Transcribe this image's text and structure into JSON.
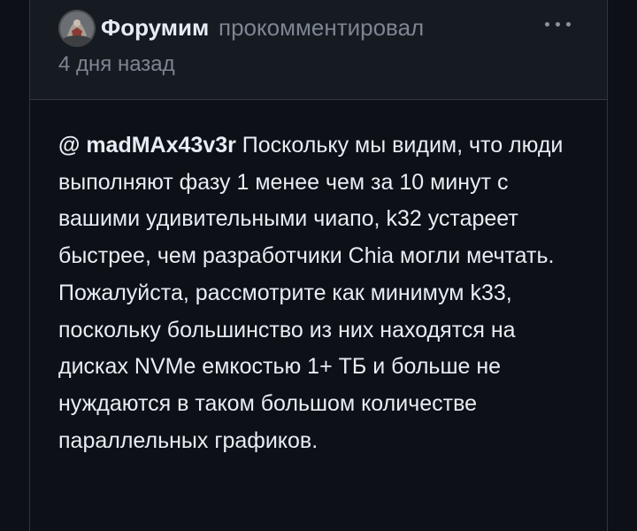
{
  "comment": {
    "author": "Форумим",
    "action": "прокомментировал",
    "timestamp": "4 дня назад",
    "mention": "@ madMAx43v3r",
    "body": " Поскольку мы видим, что люди выполняют фазу 1 менее чем за 10 минут с вашими удивительными чиапо, k32 устареет быстрее, чем разработчики Chia могли мечтать. Пожалуйста, рассмотрите как минимум k33, поскольку большинство из них находятся на дисках NVMe емкостью 1+ ТБ и больше не нуждаются в таком большом количестве параллельных графиков."
  },
  "icons": {
    "avatar": "avatar-image",
    "more": "kebab-menu-icon"
  },
  "colors": {
    "background": "#0d1117",
    "header_background": "#161b22",
    "text_primary": "#e6edf3",
    "text_muted": "#7d8590",
    "border": "#30363d"
  }
}
